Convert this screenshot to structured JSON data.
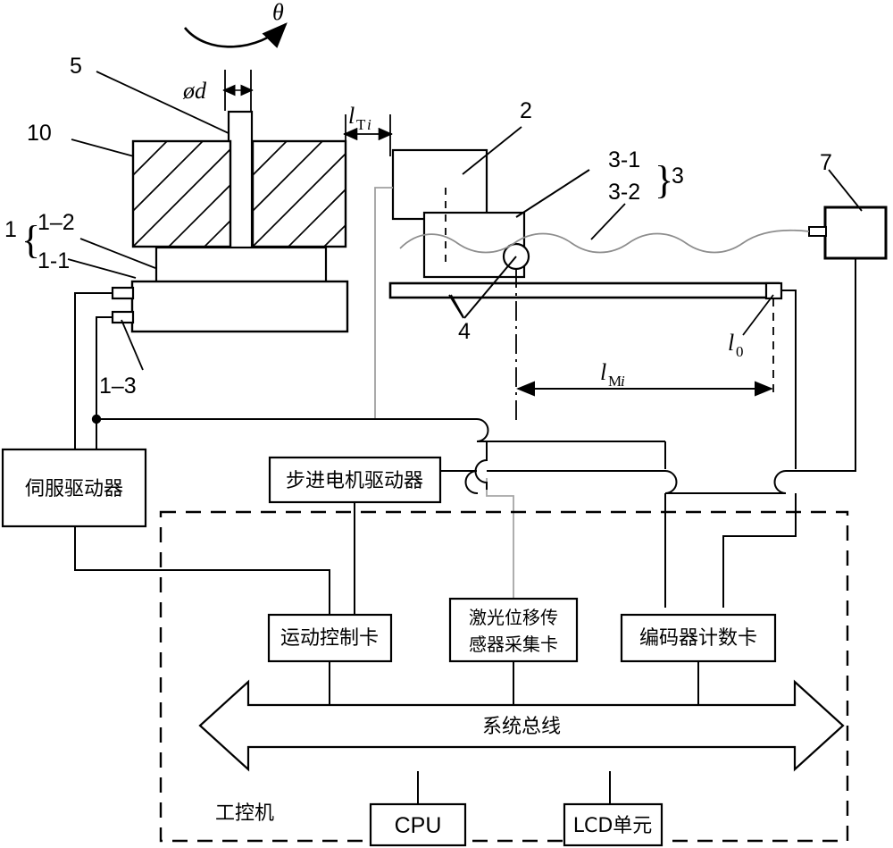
{
  "figure": {
    "type": "mechanical-measurement-system-schematic",
    "background_color": "#ffffff",
    "line_color": "#000000",
    "cable_color": "#808080"
  },
  "callouts": {
    "theta": "θ",
    "num5": "5",
    "num10": "10",
    "num1": "1",
    "num1_2": "1–2",
    "num1_1": "1-1",
    "num1_3": "1–3",
    "num2": "2",
    "num3": "3",
    "num3_1": "3-1",
    "num3_2": "3-2",
    "num4": "4",
    "num7": "7",
    "brace_left": "{",
    "brace_right": "}"
  },
  "dimensions": {
    "diameter_d": {
      "symbol": "ød"
    },
    "l_Ti": {
      "base": "l",
      "sub_cap": "T",
      "sub_ital": "i"
    },
    "l_Mi": {
      "base": "l",
      "sub_cap": "M",
      "sub_ital": "i"
    },
    "l_0": {
      "base": "l",
      "sub": "0"
    }
  },
  "blocks": {
    "servo_driver": "伺服驱动器",
    "stepper_driver": "步进电机驱动器",
    "motion_control_card": "运动控制卡",
    "laser_sensor_card_line1": "激光位移传",
    "laser_sensor_card_line2": "感器采集卡",
    "encoder_counter_card": "编码器计数卡",
    "cpu": "CPU",
    "lcd_unit": "LCD单元",
    "system_bus": "系统总线",
    "industrial_pc": "工控机"
  }
}
